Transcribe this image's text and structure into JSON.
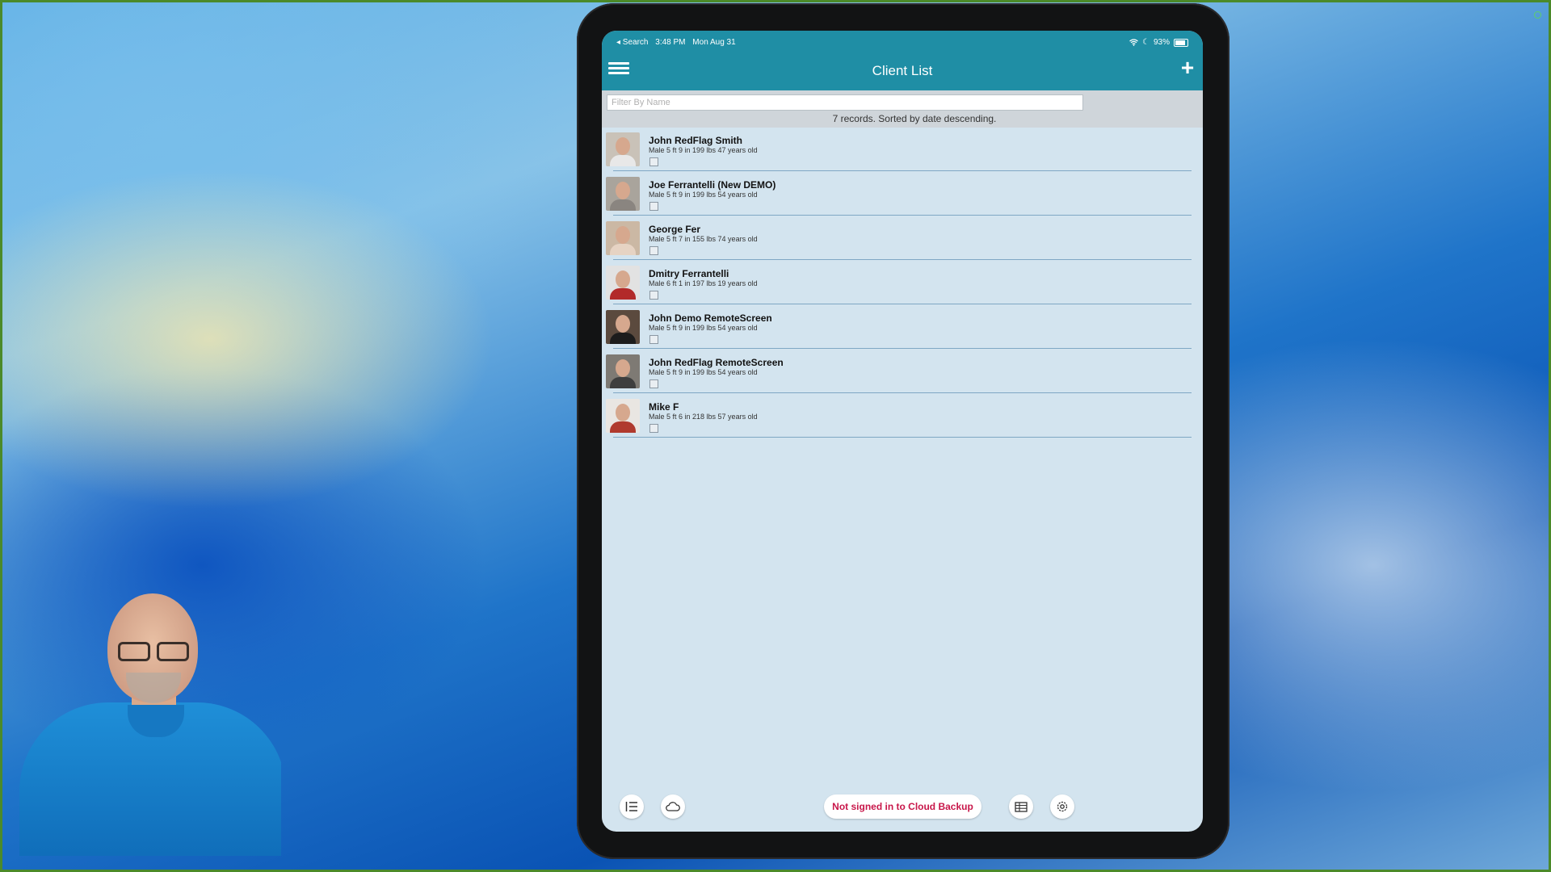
{
  "app": {
    "title": "Client List",
    "status_bar": {
      "back_label": "◂ Search",
      "time": "3:48 PM",
      "date": "Mon Aug 31",
      "battery": "93%"
    },
    "filter": {
      "placeholder": "Filter By Name",
      "value": ""
    },
    "records_info": "7 records. Sorted by date descending.",
    "clients": [
      {
        "name": "John RedFlag Smith",
        "detail": "Male 5 ft 9 in 199 lbs 47 years old",
        "bg": "#c9c2b8",
        "shirt": "#e8e8e8"
      },
      {
        "name": "Joe Ferrantelli (New DEMO)",
        "detail": "Male 5 ft 9 in 199 lbs 54 years old",
        "bg": "#a9a49c",
        "shirt": "#8a8580"
      },
      {
        "name": "George Fer",
        "detail": "Male 5 ft 7 in 155 lbs 74 years old",
        "bg": "#cbb8a4",
        "shirt": "#e6d3c3"
      },
      {
        "name": "Dmitry Ferrantelli",
        "detail": "Male 6 ft 1 in 197 lbs 19 years old",
        "bg": "#e2e2e2",
        "shirt": "#b22a2a"
      },
      {
        "name": "John Demo RemoteScreen",
        "detail": "Male 5 ft 9 in 199 lbs 54 years old",
        "bg": "#5b4a3e",
        "shirt": "#1c1c1c"
      },
      {
        "name": "John RedFlag RemoteScreen",
        "detail": "Male 5 ft 9 in 199 lbs 54 years old",
        "bg": "#7e7a74",
        "shirt": "#3e3e3e"
      },
      {
        "name": "Mike F",
        "detail": "Male 5 ft 6 in 218 lbs 57 years old",
        "bg": "#e9e6e2",
        "shirt": "#b03a2e"
      }
    ],
    "bottom": {
      "cloud_status": "Not signed in to Cloud Backup"
    },
    "icons": [
      "menu-icon",
      "plus-icon",
      "list-icon",
      "cloud-icon",
      "table-icon",
      "gear-icon",
      "wifi-icon",
      "battery-icon"
    ],
    "colors": {
      "header": "#1f8ea5",
      "background": "#d3e4ef",
      "alert": "#c8174a"
    }
  }
}
